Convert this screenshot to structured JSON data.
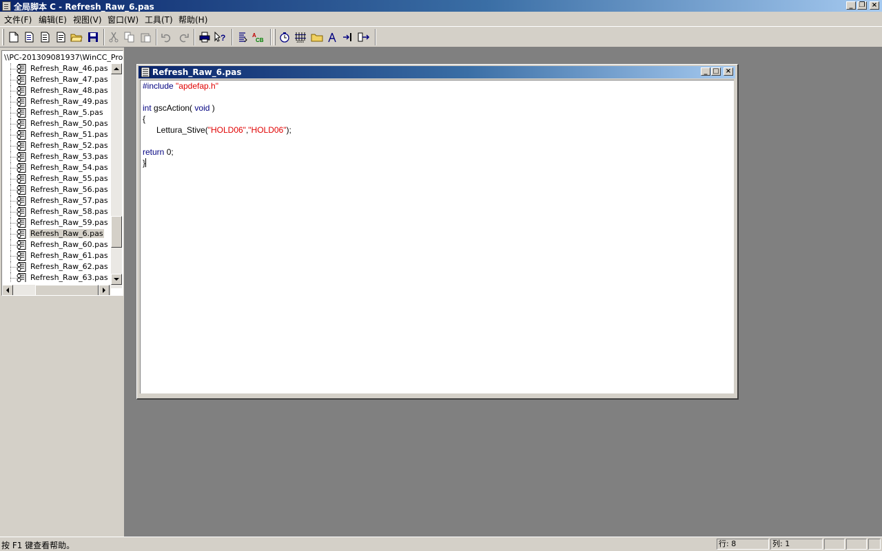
{
  "window": {
    "title": "全局脚本 C - Refresh_Raw_6.pas"
  },
  "menu": [
    {
      "label": "文件(F)"
    },
    {
      "label": "编辑(E)"
    },
    {
      "label": "视图(V)"
    },
    {
      "label": "窗口(W)"
    },
    {
      "label": "工具(T)"
    },
    {
      "label": "帮助(H)"
    }
  ],
  "toolbar": {
    "buttons": [
      "new-icon",
      "new-project-icon",
      "page-icon",
      "document-icon",
      "open-folder-icon",
      "save-icon",
      "cut-icon",
      "copy-icon",
      "paste-icon",
      "undo-icon",
      "redo-icon",
      "print-icon",
      "help-icon",
      "compile-icon",
      "cb-icon",
      "clock-icon",
      "tag-icon",
      "folder-icon",
      "tool-icon",
      "import-icon",
      "export-icon"
    ]
  },
  "tree": {
    "root": "\\\\PC-201309081937\\WinCC_Proje",
    "items": [
      {
        "label": "Refresh_Raw_46.pas"
      },
      {
        "label": "Refresh_Raw_47.pas"
      },
      {
        "label": "Refresh_Raw_48.pas"
      },
      {
        "label": "Refresh_Raw_49.pas"
      },
      {
        "label": "Refresh_Raw_5.pas"
      },
      {
        "label": "Refresh_Raw_50.pas"
      },
      {
        "label": "Refresh_Raw_51.pas"
      },
      {
        "label": "Refresh_Raw_52.pas"
      },
      {
        "label": "Refresh_Raw_53.pas"
      },
      {
        "label": "Refresh_Raw_54.pas"
      },
      {
        "label": "Refresh_Raw_55.pas"
      },
      {
        "label": "Refresh_Raw_56.pas"
      },
      {
        "label": "Refresh_Raw_57.pas"
      },
      {
        "label": "Refresh_Raw_58.pas"
      },
      {
        "label": "Refresh_Raw_59.pas"
      },
      {
        "label": "Refresh_Raw_6.pas",
        "selected": true
      },
      {
        "label": "Refresh_Raw_60.pas"
      },
      {
        "label": "Refresh_Raw_61.pas"
      },
      {
        "label": "Refresh_Raw_62.pas"
      },
      {
        "label": "Refresh_Raw_63.pas"
      }
    ]
  },
  "editor": {
    "title": "Refresh_Raw_6.pas",
    "code": {
      "l1_kw": "#include ",
      "l1_str": "\"apdefap.h\"",
      "l2_kw1": "int",
      "l2_fn": " gscAction( ",
      "l2_kw2": "void",
      "l2_end": " )",
      "l3": "{",
      "l4_fn": "      Lettura_Stive(",
      "l4_s1": "\"HOLD06\"",
      "l4_comma": ",",
      "l4_s2": "\"HOLD06\"",
      "l4_end": ");",
      "l5_kw": "return",
      "l5_end": " 0;",
      "l6": "}"
    }
  },
  "status": {
    "hint": "按 F1 键查看帮助。",
    "row": "行: 8",
    "col": "列: 1"
  }
}
